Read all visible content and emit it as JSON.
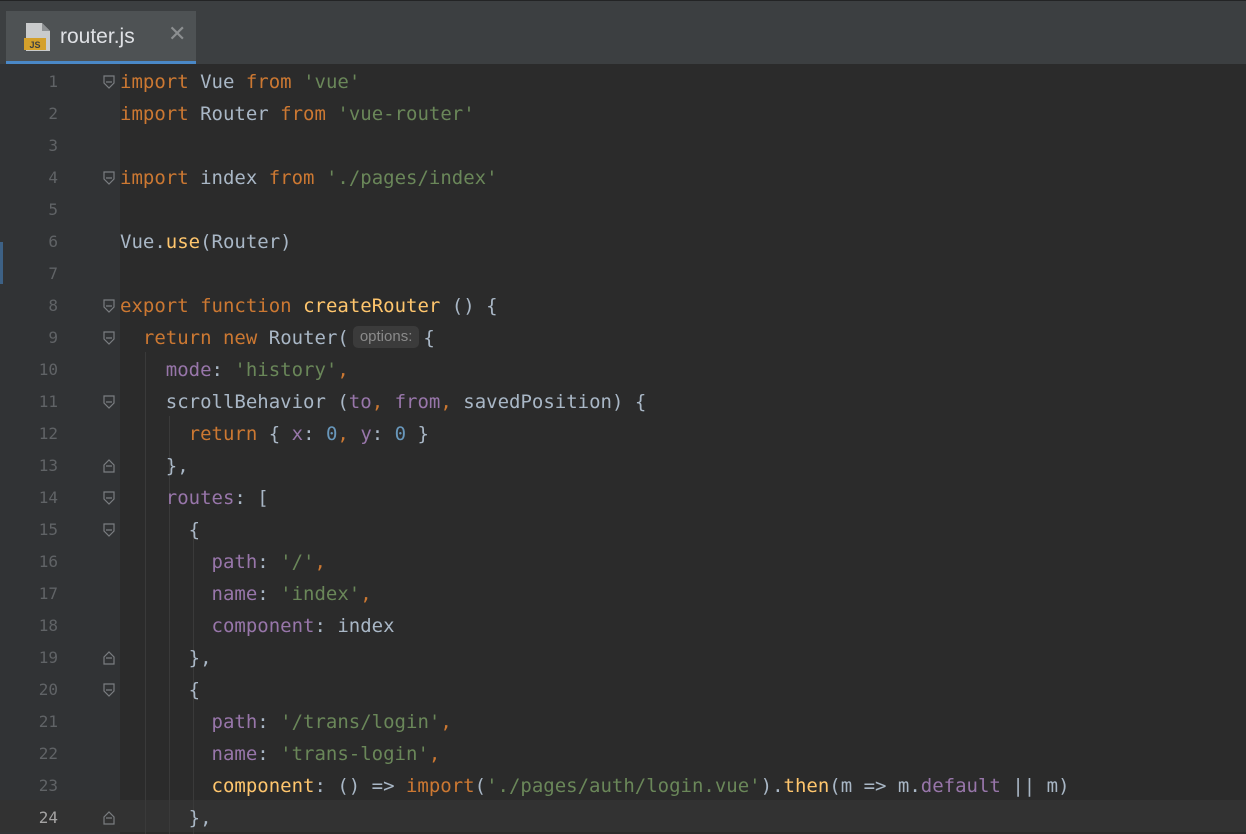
{
  "tab": {
    "filename": "router.js",
    "icon_label": "JS",
    "close_glyph": "✕"
  },
  "editor": {
    "current_line": "24",
    "lines": [
      {
        "n": "1",
        "t": [
          [
            "kw",
            "import"
          ],
          [
            "plain",
            " Vue "
          ],
          [
            "kw",
            "from"
          ],
          [
            "plain",
            " "
          ],
          [
            "str",
            "'vue'"
          ]
        ]
      },
      {
        "n": "2",
        "t": [
          [
            "kw",
            "import"
          ],
          [
            "plain",
            " Router "
          ],
          [
            "kw",
            "from"
          ],
          [
            "plain",
            " "
          ],
          [
            "str",
            "'vue-router'"
          ]
        ]
      },
      {
        "n": "3",
        "t": []
      },
      {
        "n": "4",
        "t": [
          [
            "kw",
            "import"
          ],
          [
            "plain",
            " index "
          ],
          [
            "kw",
            "from"
          ],
          [
            "plain",
            " "
          ],
          [
            "str",
            "'./pages/index'"
          ]
        ]
      },
      {
        "n": "5",
        "t": []
      },
      {
        "n": "6",
        "t": [
          [
            "plain",
            "Vue."
          ],
          [
            "fn",
            "use"
          ],
          [
            "plain",
            "(Router)"
          ]
        ]
      },
      {
        "n": "7",
        "t": []
      },
      {
        "n": "8",
        "t": [
          [
            "kw",
            "export"
          ],
          [
            "plain",
            " "
          ],
          [
            "kw",
            "function"
          ],
          [
            "plain",
            " "
          ],
          [
            "fn",
            "createRouter"
          ],
          [
            "plain",
            " () {"
          ]
        ]
      },
      {
        "n": "9",
        "t": [
          [
            "plain",
            "  "
          ],
          [
            "kw",
            "return"
          ],
          [
            "plain",
            " "
          ],
          [
            "kw",
            "new"
          ],
          [
            "plain",
            " Router("
          ],
          [
            "hint",
            "options:"
          ],
          [
            "plain",
            "{"
          ]
        ]
      },
      {
        "n": "10",
        "t": [
          [
            "plain",
            "    "
          ],
          [
            "prop",
            "mode"
          ],
          [
            "plain",
            ": "
          ],
          [
            "str",
            "'history'"
          ],
          [
            "kw",
            ","
          ]
        ]
      },
      {
        "n": "11",
        "t": [
          [
            "plain",
            "    "
          ],
          [
            "plain",
            "scrollBehavior ("
          ],
          [
            "prop",
            "to"
          ],
          [
            "kw",
            ","
          ],
          [
            "plain",
            " "
          ],
          [
            "prop",
            "from"
          ],
          [
            "kw",
            ","
          ],
          [
            "plain",
            " savedPosition) {"
          ]
        ]
      },
      {
        "n": "12",
        "t": [
          [
            "plain",
            "      "
          ],
          [
            "kw",
            "return"
          ],
          [
            "plain",
            " { "
          ],
          [
            "prop",
            "x"
          ],
          [
            "plain",
            ": "
          ],
          [
            "num",
            "0"
          ],
          [
            "kw",
            ","
          ],
          [
            "plain",
            " "
          ],
          [
            "prop",
            "y"
          ],
          [
            "plain",
            ": "
          ],
          [
            "num",
            "0"
          ],
          [
            "plain",
            " }"
          ]
        ]
      },
      {
        "n": "13",
        "t": [
          [
            "plain",
            "    },"
          ]
        ]
      },
      {
        "n": "14",
        "t": [
          [
            "plain",
            "    "
          ],
          [
            "prop",
            "routes"
          ],
          [
            "plain",
            ": ["
          ]
        ]
      },
      {
        "n": "15",
        "t": [
          [
            "plain",
            "      {"
          ]
        ]
      },
      {
        "n": "16",
        "t": [
          [
            "plain",
            "        "
          ],
          [
            "prop",
            "path"
          ],
          [
            "plain",
            ": "
          ],
          [
            "str",
            "'/'"
          ],
          [
            "kw",
            ","
          ]
        ]
      },
      {
        "n": "17",
        "t": [
          [
            "plain",
            "        "
          ],
          [
            "prop",
            "name"
          ],
          [
            "plain",
            ": "
          ],
          [
            "str",
            "'index'"
          ],
          [
            "kw",
            ","
          ]
        ]
      },
      {
        "n": "18",
        "t": [
          [
            "plain",
            "        "
          ],
          [
            "prop",
            "component"
          ],
          [
            "plain",
            ": index"
          ]
        ]
      },
      {
        "n": "19",
        "t": [
          [
            "plain",
            "      },"
          ]
        ]
      },
      {
        "n": "20",
        "t": [
          [
            "plain",
            "      {"
          ]
        ]
      },
      {
        "n": "21",
        "t": [
          [
            "plain",
            "        "
          ],
          [
            "prop",
            "path"
          ],
          [
            "plain",
            ": "
          ],
          [
            "str",
            "'/trans/login'"
          ],
          [
            "kw",
            ","
          ]
        ]
      },
      {
        "n": "22",
        "t": [
          [
            "plain",
            "        "
          ],
          [
            "prop",
            "name"
          ],
          [
            "plain",
            ": "
          ],
          [
            "str",
            "'trans-login'"
          ],
          [
            "kw",
            ","
          ]
        ]
      },
      {
        "n": "23",
        "t": [
          [
            "plain",
            "        "
          ],
          [
            "fn",
            "component"
          ],
          [
            "plain",
            ": () => "
          ],
          [
            "kw",
            "import"
          ],
          [
            "plain",
            "("
          ],
          [
            "str",
            "'./pages/auth/login.vue'"
          ],
          [
            "plain",
            ")."
          ],
          [
            "fn",
            "then"
          ],
          [
            "plain",
            "(m => m."
          ],
          [
            "prop",
            "default"
          ],
          [
            "plain",
            " || m)"
          ]
        ]
      },
      {
        "n": "24",
        "t": [
          [
            "plain",
            "      },"
          ]
        ]
      }
    ]
  },
  "colors": {
    "background": "#2b2b2b",
    "gutter": "#313335",
    "keyword": "#cc7832",
    "string": "#6a8759",
    "function": "#ffc66d",
    "property": "#9876aa",
    "number": "#6897bb",
    "text": "#a9b7c6"
  },
  "icons": {
    "file_type": "js-file-icon",
    "close": "close-icon",
    "fold_start": "fold-start-icon",
    "fold_end": "fold-end-icon"
  }
}
